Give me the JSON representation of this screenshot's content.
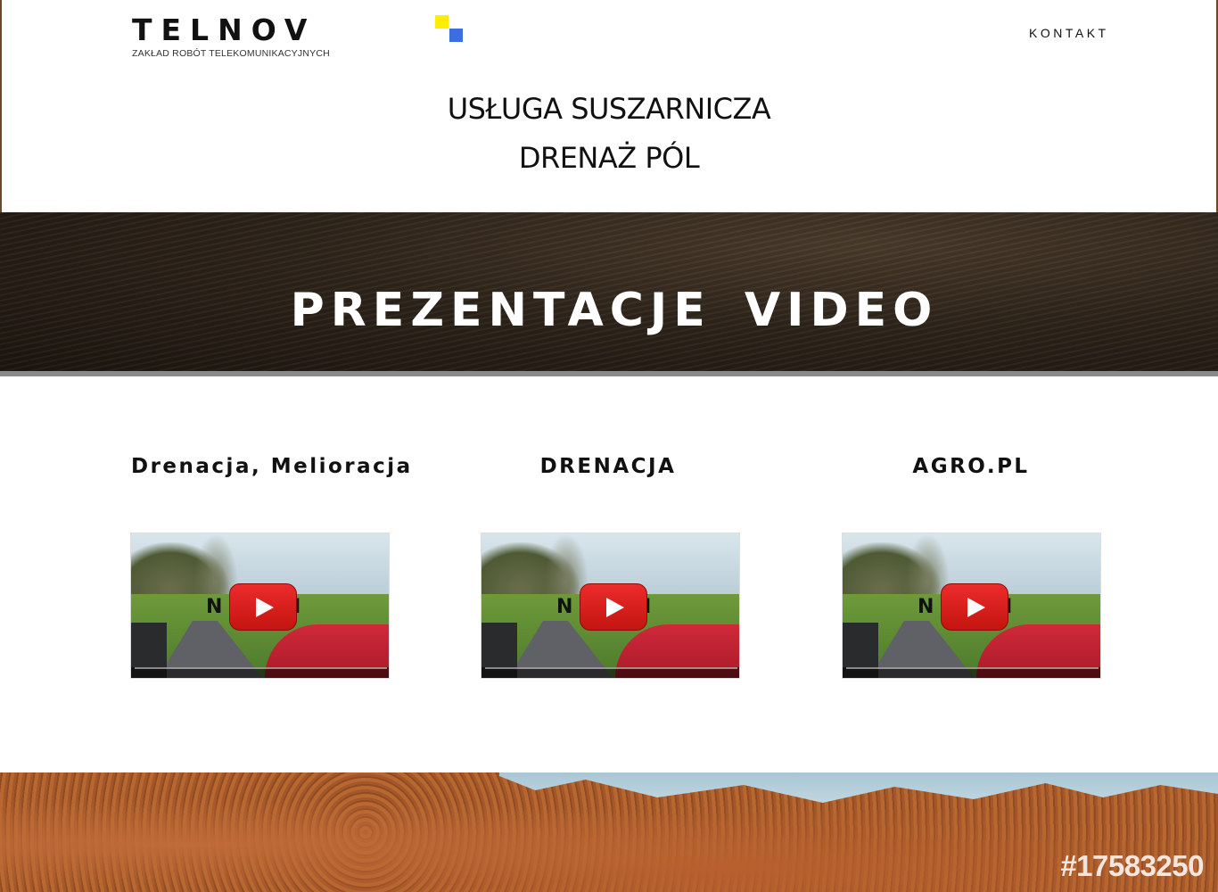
{
  "header": {
    "logo_text": "TELNOV",
    "logo_subtitle": "ZAKŁAD ROBÓT TELEKOMUNIKACYJNYCH",
    "nav": {
      "kontakt": "KONTAKT"
    },
    "taglines": [
      "USŁUGA SUSZARNICZA",
      "DRENAŻ PÓL"
    ],
    "colors": {
      "logo_yellow": "#ffee00",
      "logo_blue": "#3b6fe0"
    }
  },
  "banner": {
    "title": "PREZENTACJE  VIDEO"
  },
  "videos": [
    {
      "title": "Drenacja, Melioracja",
      "brand": "N       KI",
      "icon": "youtube-play-icon"
    },
    {
      "title": "DRENACJA",
      "brand": "N       KI",
      "icon": "youtube-play-icon"
    },
    {
      "title": "AGRO.PL",
      "brand": "N       KI",
      "icon": "youtube-play-icon"
    }
  ],
  "footer": {
    "watermark": "#17583250"
  }
}
